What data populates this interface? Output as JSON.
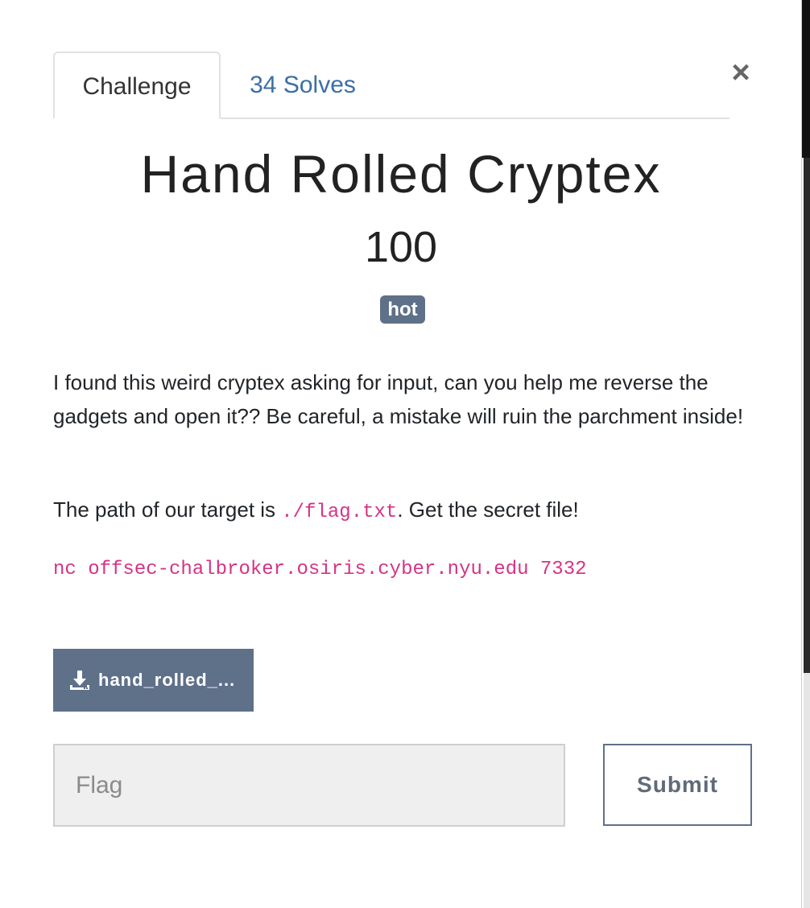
{
  "tabs": [
    {
      "label": "Challenge"
    },
    {
      "label": "34 Solves"
    }
  ],
  "close": {
    "glyph": "×"
  },
  "challenge": {
    "title": "Hand Rolled Cryptex",
    "points": "100",
    "tag": "hot",
    "description": "I found this weird cryptex asking for input, can you help me reverse the gadgets and open it?? Be careful, a mistake will ruin the parchment inside!",
    "path_prefix": "The path of our target is ",
    "path_code": "./flag.txt",
    "path_suffix": ". Get the secret file!",
    "command": "nc offsec-chalbroker.osiris.cyber.nyu.edu 7332"
  },
  "download": {
    "label": "hand_rolled_...",
    "icon": "download-icon"
  },
  "flag_form": {
    "placeholder": "Flag",
    "value": "",
    "submit_label": "Submit"
  },
  "colors": {
    "accent": "#5f7089",
    "link": "#3b6ea5",
    "code": "#d63384"
  }
}
